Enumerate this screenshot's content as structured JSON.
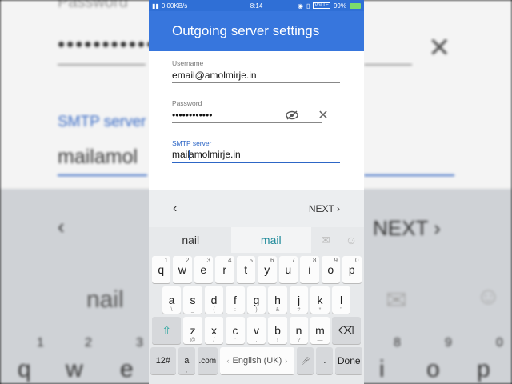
{
  "status": {
    "speed": "0.00KB/s",
    "time": "8:14",
    "lte": "VoLTE",
    "battery": "99%"
  },
  "appbar": {
    "title": "Outgoing server settings"
  },
  "form": {
    "username": {
      "label": "Username",
      "value": "email@amolmirje.in"
    },
    "password": {
      "label": "Password",
      "value": "••••••••••••"
    },
    "smtp": {
      "label": "SMTP server",
      "value_before_cursor": "mail",
      "value_after_cursor": "amolmirje.in"
    }
  },
  "nav": {
    "prev": "‹",
    "next": "NEXT ›"
  },
  "suggestions": [
    "nail",
    "mail"
  ],
  "keyboard": {
    "row1": [
      [
        "q",
        "1"
      ],
      [
        "w",
        "2"
      ],
      [
        "e",
        "3"
      ],
      [
        "r",
        "4"
      ],
      [
        "t",
        "5"
      ],
      [
        "y",
        "6"
      ],
      [
        "u",
        "7"
      ],
      [
        "i",
        "8"
      ],
      [
        "o",
        "9"
      ],
      [
        "p",
        "0"
      ]
    ],
    "row2": [
      [
        "a",
        "\\"
      ],
      [
        "s",
        "_"
      ],
      [
        "d",
        "("
      ],
      [
        "f",
        ":"
      ],
      [
        "g",
        ")"
      ],
      [
        "h",
        "&"
      ],
      [
        "j",
        "#"
      ],
      [
        "k",
        "*"
      ],
      [
        "l",
        "\""
      ]
    ],
    "row3": [
      [
        "z",
        "@"
      ],
      [
        "x",
        "/"
      ],
      [
        "c",
        "'"
      ],
      [
        "v",
        "."
      ],
      [
        "b",
        "!"
      ],
      [
        "n",
        "?"
      ],
      [
        "m",
        "—"
      ]
    ],
    "symbols_label": "12#",
    "at_label": "a",
    "dotcom_label": ".com",
    "space_label": "English (UK)",
    "period_label": ".",
    "done_label": "Done"
  },
  "background": {
    "password_label": "Password",
    "smtp_label": "SMTP server",
    "smtp_value_a": "mail",
    "smtp_value_b": "amol",
    "next": "NEXT",
    "nail": "nail",
    "left_keys": [
      "q",
      "w",
      "e"
    ],
    "right_keys": [
      "i",
      "o",
      "p"
    ],
    "left_nums": [
      "1",
      "2",
      "3"
    ],
    "right_nums": [
      "8",
      "9",
      "0"
    ],
    "dots": "•••••••••••••"
  }
}
